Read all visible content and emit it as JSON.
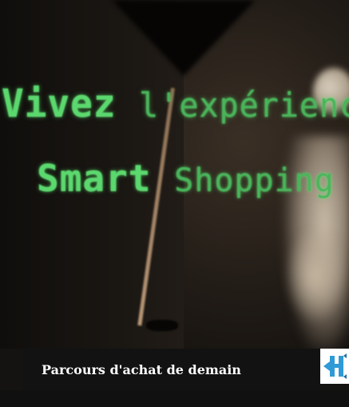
{
  "hero": {
    "led_line1_a": "Vivez ",
    "led_line1_b": "l'expérience",
    "led_line2_a": "Smart ",
    "led_line2_b": "Shopping"
  },
  "caption": {
    "title": "Parcours d'achat de demain"
  },
  "brand": {
    "logo_icon": "brand-logo-icon",
    "accent_color": "#2f9bd6"
  }
}
